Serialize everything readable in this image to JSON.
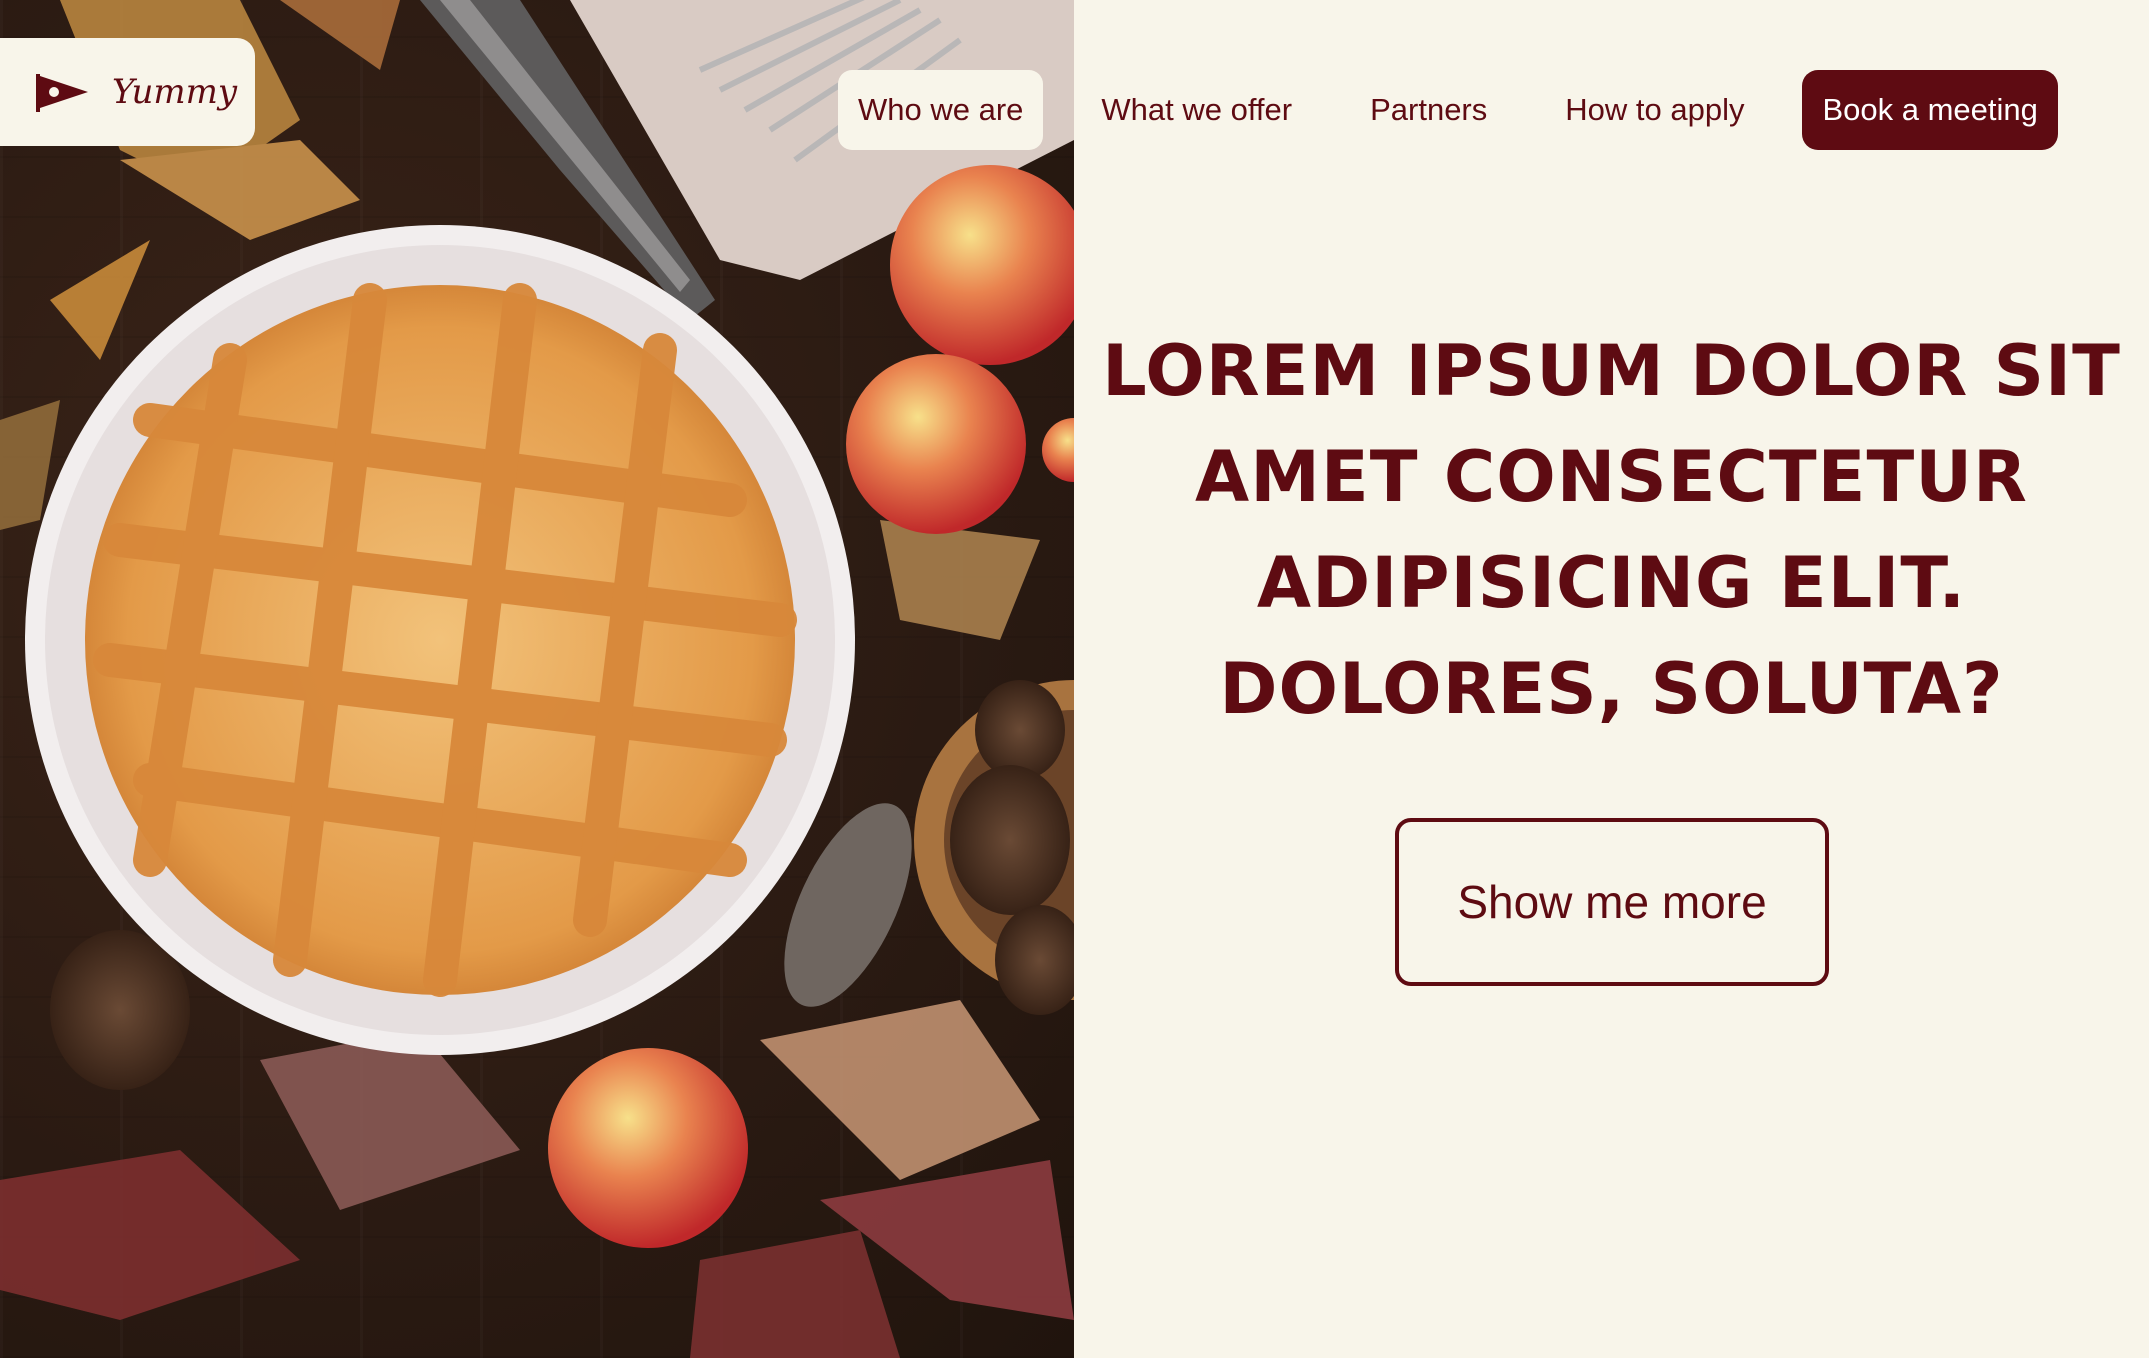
{
  "brand": {
    "name": "Yummy",
    "icon": "play-flag-icon"
  },
  "nav": {
    "items": [
      "Who we are",
      "What we offer",
      "Partners",
      "How to apply"
    ],
    "active_index": 0,
    "cta_label": "Book a meeting"
  },
  "hero": {
    "headline": "LOREM IPSUM DOLOR SIT AMET CONSECTETUR ADIPISICING ELIT. DOLORES, SOLUTA?",
    "button_label": "Show me more"
  },
  "colors": {
    "accent": "#5e0b12",
    "background": "#f8f5ea"
  }
}
